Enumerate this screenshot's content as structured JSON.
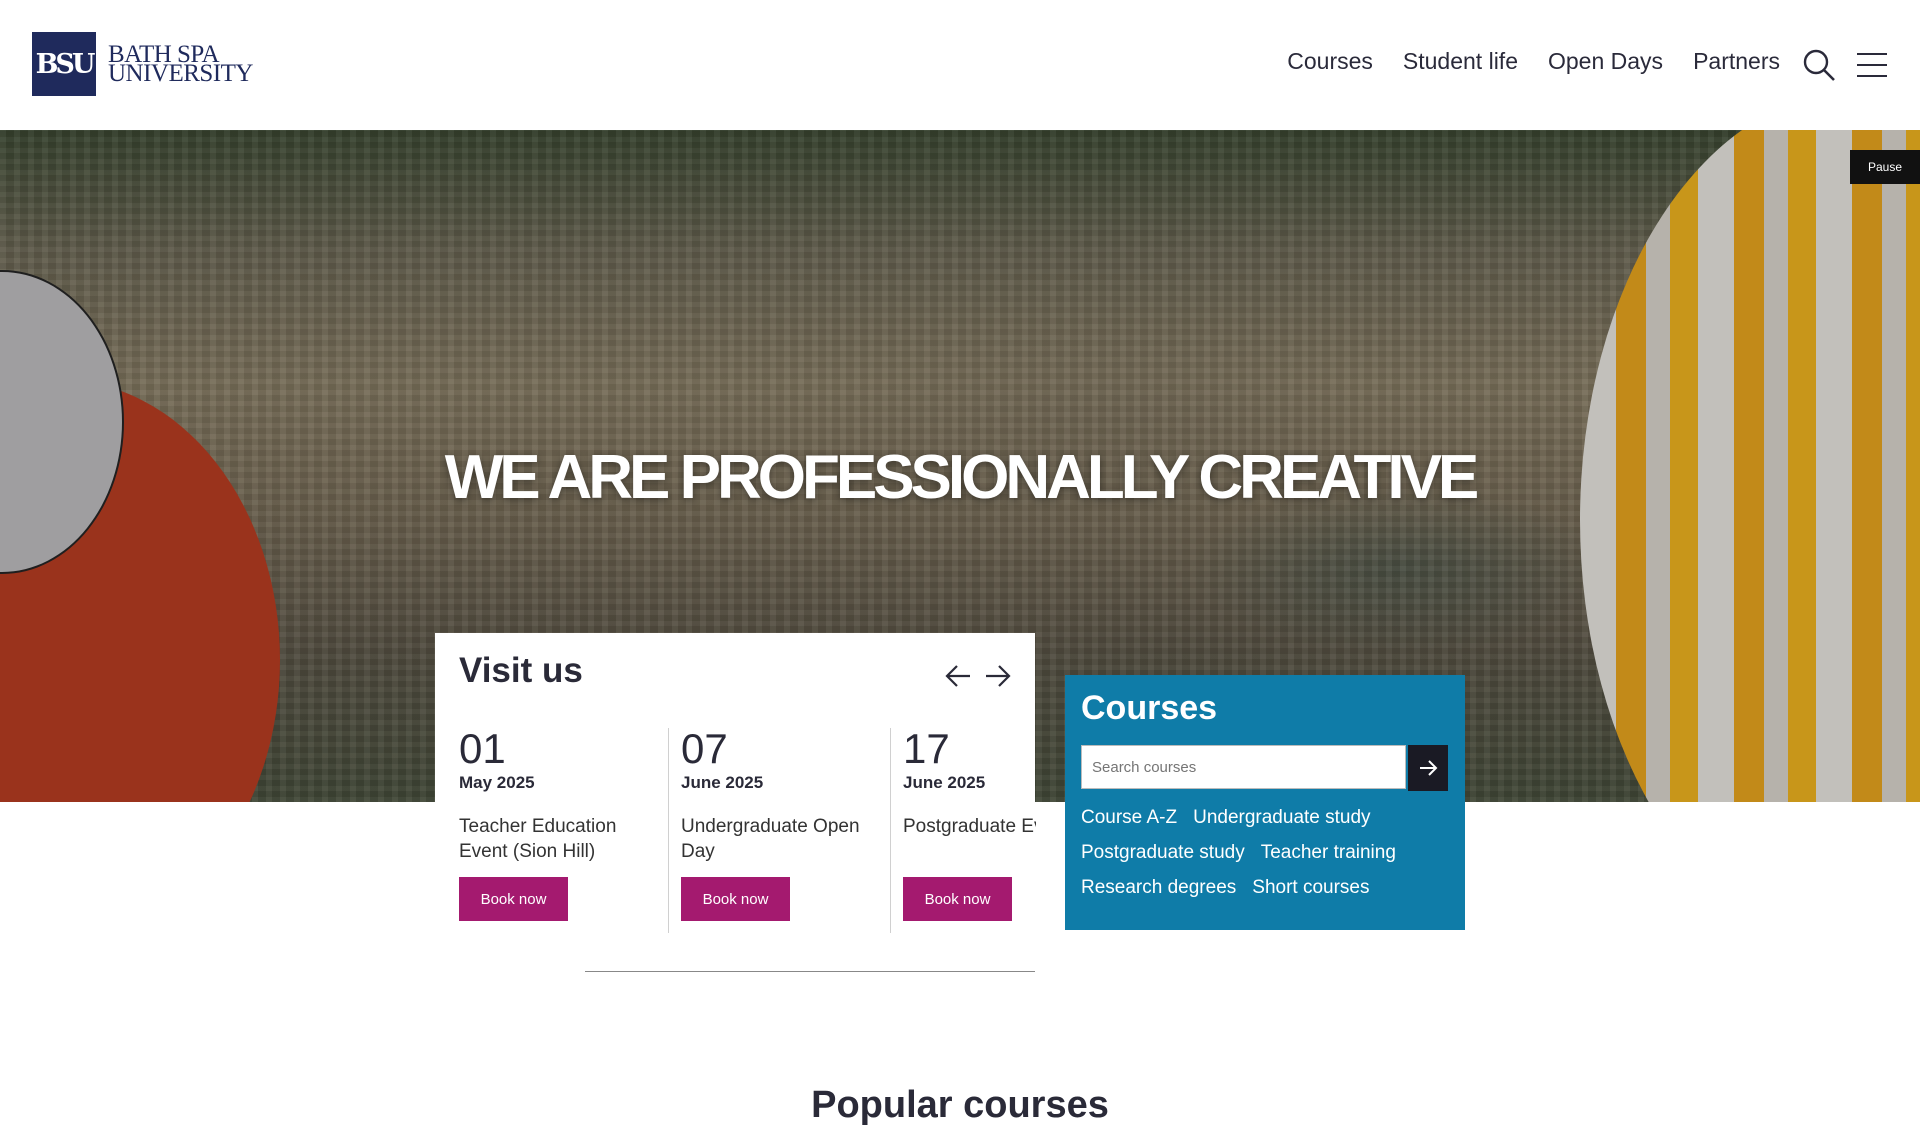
{
  "header": {
    "logo_mark": "BSU",
    "logo_line1": "BATH SPA",
    "logo_line2": "UNIVERSITY",
    "nav": [
      "Courses",
      "Student life",
      "Open Days",
      "Partners"
    ],
    "search_icon": "search-icon",
    "menu_icon": "hamburger-menu-icon"
  },
  "hero": {
    "title": "WE ARE PROFESSIONALLY CREATIVE",
    "pause_label": "Pause"
  },
  "visit": {
    "title": "Visit us",
    "prev_icon": "arrow-left-icon",
    "next_icon": "arrow-right-icon",
    "events": [
      {
        "day": "01",
        "month": "May 2025",
        "title": "Teacher Education Event (Sion Hill)",
        "button": "Book now"
      },
      {
        "day": "07",
        "month": "June 2025",
        "title": "Undergraduate Open Day",
        "button": "Book now"
      },
      {
        "day": "17",
        "month": "June 2025",
        "title": "Postgraduate Evening",
        "button": "Book now"
      }
    ]
  },
  "courses": {
    "title": "Courses",
    "search_placeholder": "Search courses",
    "submit_icon": "arrow-right-icon",
    "links": [
      "Course A-Z",
      "Undergraduate study",
      "Postgraduate study",
      "Teacher training",
      "Research degrees",
      "Short courses"
    ]
  },
  "popular": {
    "title": "Popular courses"
  },
  "colors": {
    "brand_navy": "#1f2a5c",
    "accent_magenta": "#a41a6f",
    "courses_blue": "#0f7ca8"
  }
}
